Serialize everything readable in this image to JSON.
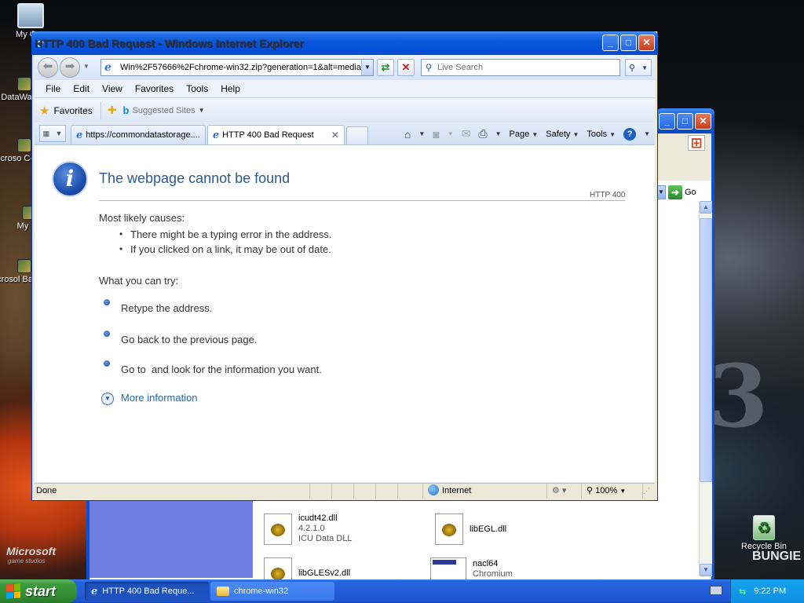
{
  "desktop": {
    "icons": [
      {
        "label": "My Con"
      },
      {
        "label": "DataWa"
      },
      {
        "label": "Microso C++"
      },
      {
        "label": "My"
      },
      {
        "label": "Microsol Basic"
      }
    ],
    "recycle_bin": "Recycle Bin",
    "brand_left": "Microsoft",
    "brand_left_sub": "game studios",
    "brand_right": "BUNGIE"
  },
  "explorer": {
    "go_label": "Go",
    "files": [
      {
        "name": "icudt42.dll",
        "version": "4.2.1.0",
        "description": "ICU Data DLL"
      },
      {
        "name": "libEGL.dll"
      },
      {
        "name": "libGLESv2.dll"
      },
      {
        "name": "nacl64",
        "description": "Chromium"
      }
    ]
  },
  "ie": {
    "title": "HTTP 400 Bad Request - Windows Internet Explorer",
    "address": "Win%2F57666%2Fchrome-win32.zip?generation=1&alt=media",
    "search_placeholder": "Live Search",
    "menu": [
      "File",
      "Edit",
      "View",
      "Favorites",
      "Tools",
      "Help"
    ],
    "favorites_label": "Favorites",
    "suggested_sites": "Suggested Sites",
    "tabs": [
      {
        "label": "https://commondatastorage....",
        "active": false
      },
      {
        "label": "HTTP 400 Bad Request",
        "active": true
      }
    ],
    "command_bar": {
      "page": "Page",
      "safety": "Safety",
      "tools": "Tools"
    },
    "page": {
      "heading": "The webpage cannot be found",
      "http_code": "HTTP 400",
      "causes_title": "Most likely causes:",
      "causes": [
        "There might be a typing error in the address.",
        "If you clicked on a link, it may be out of date."
      ],
      "try_title": "What you can try:",
      "tries": [
        "Retype the address.",
        "Go back to the previous page.",
        "Go to  and look for the information you want."
      ],
      "more_info": "More information"
    },
    "status": {
      "left": "Done",
      "zone": "Internet",
      "zoom": "100%"
    }
  },
  "taskbar": {
    "start": "start",
    "tasks": [
      {
        "label": "HTTP 400 Bad Reque..."
      },
      {
        "label": "chrome-win32"
      }
    ],
    "clock": "9:22 PM"
  }
}
